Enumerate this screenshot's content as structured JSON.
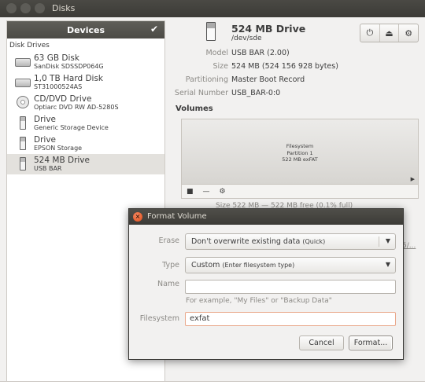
{
  "window": {
    "title": "Disks"
  },
  "sidebar": {
    "header": "Devices",
    "header_icon": "checkmark-icon",
    "group_label": "Disk Drives",
    "drives": [
      {
        "name": "63 GB Disk",
        "sub": "SanDisk SDSSDP064G",
        "icon": "hard-disk-icon"
      },
      {
        "name": "1,0 TB Hard Disk",
        "sub": "ST31000524AS",
        "icon": "hard-disk-icon"
      },
      {
        "name": "CD/DVD Drive",
        "sub": "Optiarc DVD RW AD-5280S",
        "icon": "optical-disc-icon"
      },
      {
        "name": "Drive",
        "sub": "Generic Storage Device",
        "icon": "usb-drive-icon"
      },
      {
        "name": "Drive",
        "sub": "EPSON Storage",
        "icon": "usb-drive-icon"
      },
      {
        "name": "524 MB Drive",
        "sub": "USB BAR",
        "icon": "usb-drive-icon",
        "selected": true
      }
    ]
  },
  "main": {
    "title": "524 MB Drive",
    "device": "/dev/sde",
    "toolbar": {
      "power": "⏻",
      "eject": "⏏",
      "settings": "⚙"
    },
    "properties": [
      {
        "label": "Model",
        "value": "USB BAR (2.00)"
      },
      {
        "label": "Size",
        "value": "524 MB (524 156 928 bytes)"
      },
      {
        "label": "Partitioning",
        "value": "Master Boot Record"
      },
      {
        "label": "Serial Number",
        "value": "USB_BAR-0:0"
      }
    ],
    "volumes_heading": "Volumes",
    "volume": {
      "line1": "Filesystem",
      "line2": "Partition 1",
      "line3": "522 MB exFAT"
    },
    "volume_tools": {
      "stop": "■",
      "remove": "—",
      "more": "⚙"
    },
    "size_text": "Size   522 MB — 522 MB free (0.1% full)",
    "link_text": "5/..."
  },
  "dialog": {
    "title": "Format Volume",
    "erase": {
      "label": "Erase",
      "value": "Don't overwrite existing data",
      "suffix": "(Quick)"
    },
    "type": {
      "label": "Type",
      "value": "Custom",
      "suffix": "(Enter filesystem type)"
    },
    "name": {
      "label": "Name",
      "value": "",
      "hint": "For example, \"My Files\" or \"Backup Data\""
    },
    "filesystem": {
      "label": "Filesystem",
      "value": "exfat"
    },
    "cancel_label": "Cancel",
    "format_label": "Format..."
  }
}
